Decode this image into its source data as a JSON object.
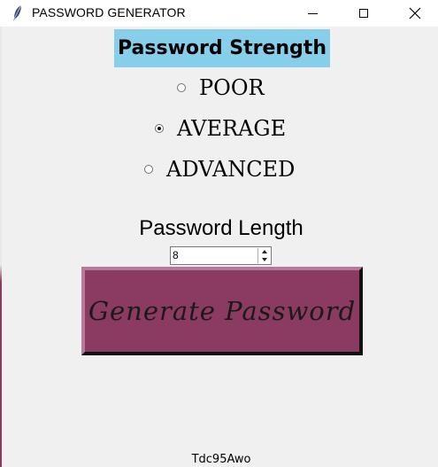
{
  "window": {
    "title": "PASSWORD GENERATOR",
    "icon": "feather-icon",
    "controls": [
      "minimize-icon",
      "maximize-icon",
      "close-icon"
    ]
  },
  "strength": {
    "title": "Password Strength",
    "title_bg": "#87ceeb",
    "options": [
      {
        "label": "POOR",
        "checked": false
      },
      {
        "label": "AVERAGE",
        "checked": true
      },
      {
        "label": "ADVANCED",
        "checked": false
      }
    ]
  },
  "length": {
    "label": "Password Length",
    "value": "8"
  },
  "generate": {
    "label": "Generate Password",
    "color": "#8b3a62"
  },
  "output": {
    "password": "Tdc95Awo"
  }
}
